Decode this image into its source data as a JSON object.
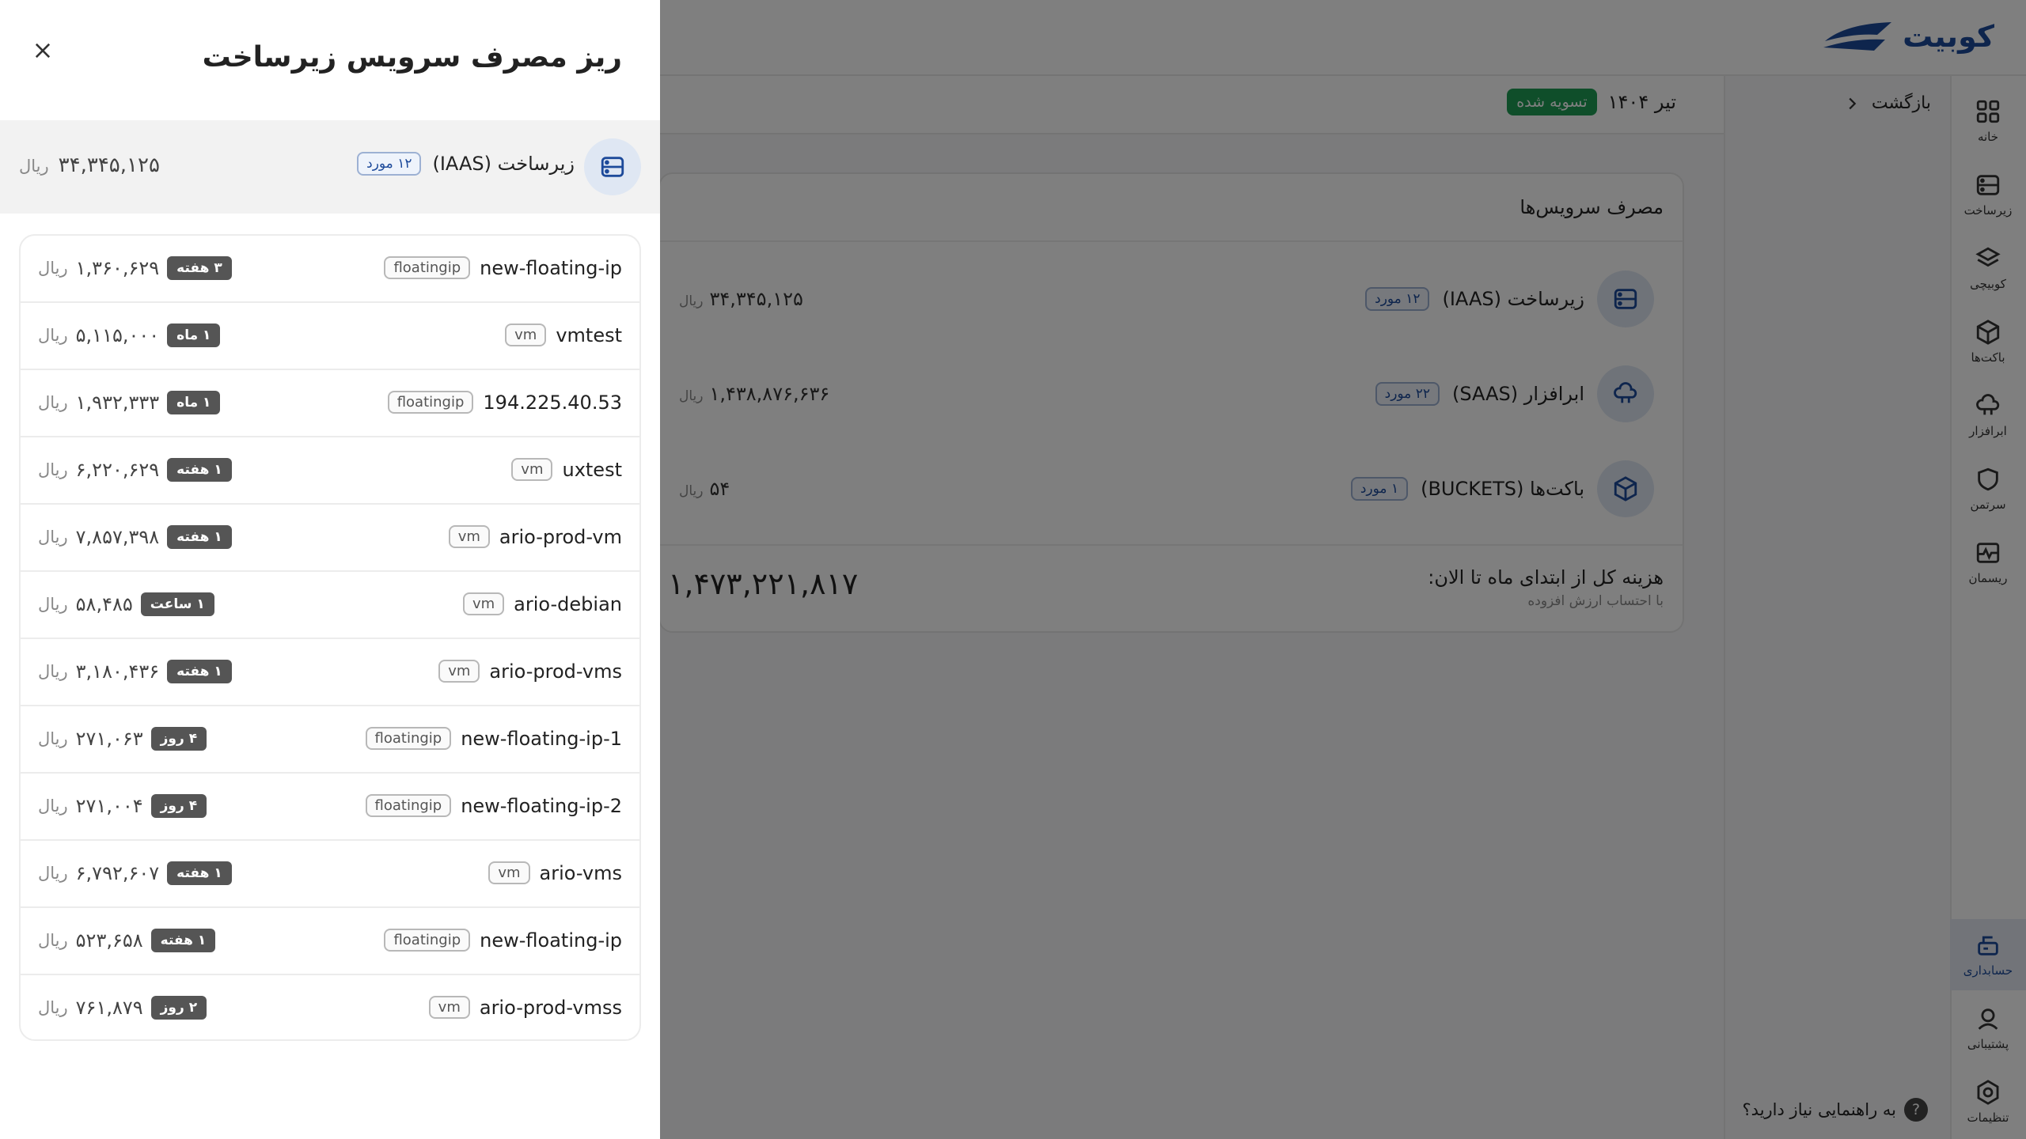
{
  "brand": {
    "name": "کوبیت",
    "primary": "#1d4a9a",
    "success": "#1f9d55"
  },
  "sidebar": {
    "items": [
      {
        "label": "خانه",
        "icon": "grid-icon"
      },
      {
        "label": "زیرساخت",
        "icon": "server-icon"
      },
      {
        "label": "کوبیچی",
        "icon": "layers-icon"
      },
      {
        "label": "باکت‌ها",
        "icon": "box-icon"
      },
      {
        "label": "ابرافزار",
        "icon": "cloud-icon"
      },
      {
        "label": "سرتمن",
        "icon": "shield-icon"
      },
      {
        "label": "ریسمان",
        "icon": "pulse-icon"
      }
    ],
    "bottom_items": [
      {
        "label": "حسابداری",
        "icon": "accounting-icon",
        "active": true
      },
      {
        "label": "پشتیبانی",
        "icon": "support-icon"
      },
      {
        "label": "تنظیمات",
        "icon": "settings-icon"
      }
    ]
  },
  "topbar": {
    "back_label": "بازگشت",
    "month": "تیر ۱۴۰۴",
    "status": "تسویه شده"
  },
  "services_card": {
    "title": "مصرف سرویس‌ها",
    "rows": [
      {
        "name": "زیرساخت (IAAS)",
        "count": "۱۲ مورد",
        "amount": "۳۴,۳۴۵,۱۲۵",
        "currency": "ریال",
        "icon": "server-icon"
      },
      {
        "name": "ابرافزار (SAAS)",
        "count": "۲۲ مورد",
        "amount": "۱,۴۳۸,۸۷۶,۶۳۶",
        "currency": "ریال",
        "icon": "cloud-icon"
      },
      {
        "name": "باکت‌ها (BUCKETS)",
        "count": "۱ مورد",
        "amount": "۵۴",
        "currency": "ریال",
        "icon": "box-icon"
      }
    ],
    "total_label": "هزینه کل از ابتدای ماه تا الان:",
    "total_sub": "با احتساب ارزش افزوده",
    "total_amount": "۱,۴۷۳,۲۲۱,۸۱۷"
  },
  "help_text": "به راهنمایی نیاز دارید؟",
  "drawer": {
    "title": "ریز مصرف سرویس زیرساخت",
    "summary": {
      "name": "زیرساخت (IAAS)",
      "count": "۱۲ مورد",
      "amount": "۳۴,۳۴۵,۱۲۵",
      "currency": "ریال"
    },
    "items": [
      {
        "name": "new-floating-ip",
        "type": "floatingip",
        "duration": "۳ هفته",
        "amount": "۱,۳۶۰,۶۲۹",
        "currency": "ریال"
      },
      {
        "name": "vmtest",
        "type": "vm",
        "duration": "۱ ماه",
        "amount": "۵,۱۱۵,۰۰۰",
        "currency": "ریال"
      },
      {
        "name": "194.225.40.53",
        "type": "floatingip",
        "duration": "۱ ماه",
        "amount": "۱,۹۳۲,۳۳۳",
        "currency": "ریال"
      },
      {
        "name": "uxtest",
        "type": "vm",
        "duration": "۱ هفته",
        "amount": "۶,۲۲۰,۶۲۹",
        "currency": "ریال"
      },
      {
        "name": "ario-prod-vm",
        "type": "vm",
        "duration": "۱ هفته",
        "amount": "۷,۸۵۷,۳۹۸",
        "currency": "ریال"
      },
      {
        "name": "ario-debian",
        "type": "vm",
        "duration": "۱ ساعت",
        "amount": "۵۸,۴۸۵",
        "currency": "ریال"
      },
      {
        "name": "ario-prod-vms",
        "type": "vm",
        "duration": "۱ هفته",
        "amount": "۳,۱۸۰,۴۳۶",
        "currency": "ریال"
      },
      {
        "name": "new-floating-ip-1",
        "type": "floatingip",
        "duration": "۴ روز",
        "amount": "۲۷۱,۰۶۳",
        "currency": "ریال"
      },
      {
        "name": "new-floating-ip-2",
        "type": "floatingip",
        "duration": "۴ روز",
        "amount": "۲۷۱,۰۰۴",
        "currency": "ریال"
      },
      {
        "name": "ario-vms",
        "type": "vm",
        "duration": "۱ هفته",
        "amount": "۶,۷۹۲,۶۰۷",
        "currency": "ریال"
      },
      {
        "name": "new-floating-ip",
        "type": "floatingip",
        "duration": "۱ هفته",
        "amount": "۵۲۳,۶۵۸",
        "currency": "ریال"
      },
      {
        "name": "ario-prod-vmss",
        "type": "vm",
        "duration": "۲ روز",
        "amount": "۷۶۱,۸۷۹",
        "currency": "ریال"
      }
    ]
  }
}
